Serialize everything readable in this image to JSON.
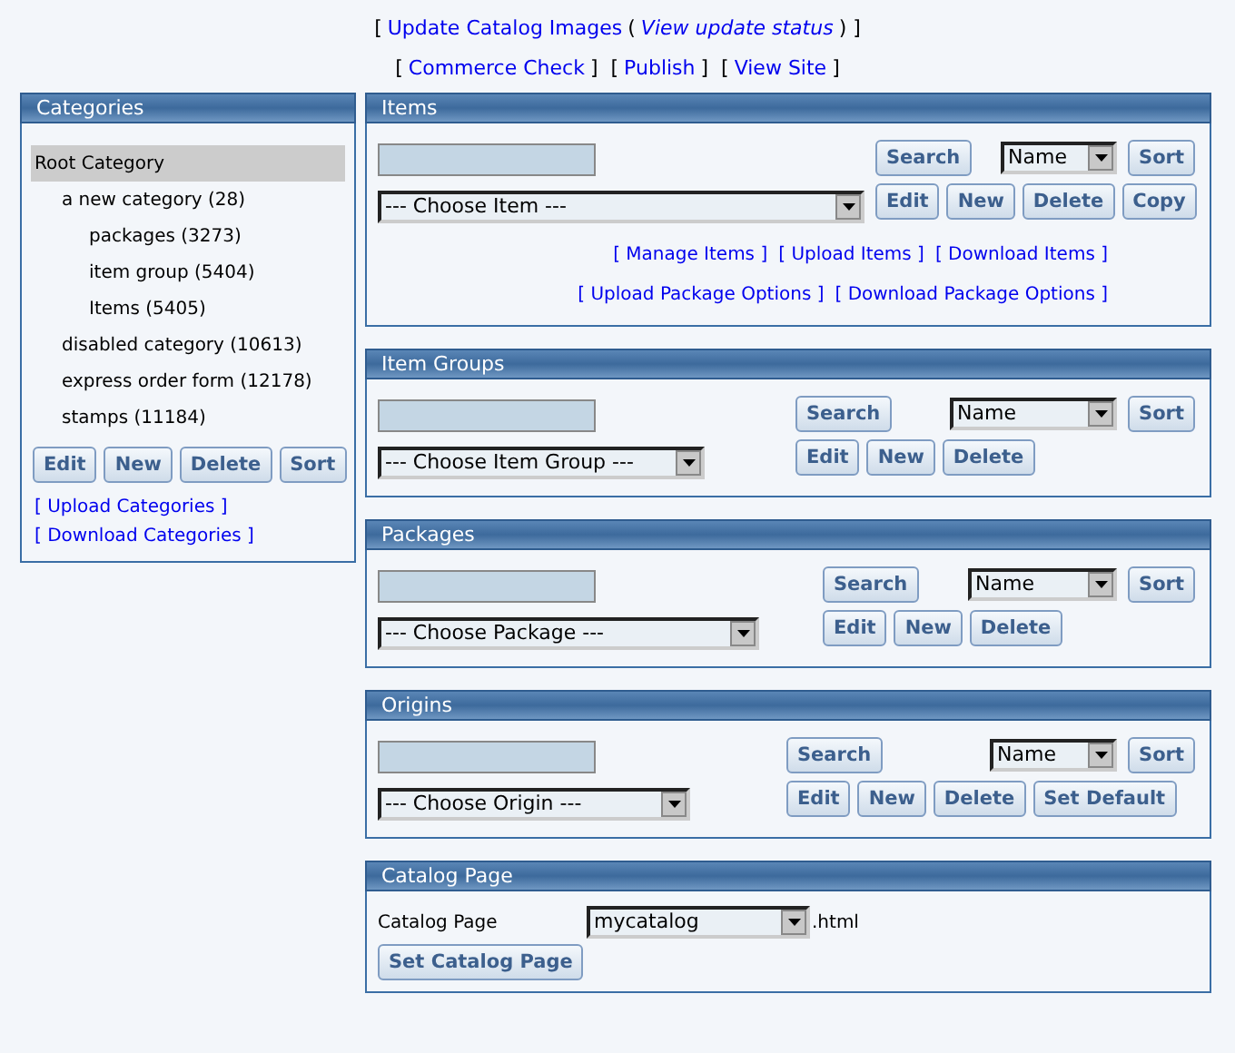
{
  "top_links": [
    [
      {
        "kind": "text",
        "text": "["
      },
      {
        "kind": "link",
        "text": "Update Catalog Images"
      },
      {
        "kind": "text",
        "text": "("
      },
      {
        "kind": "italic_link",
        "text": "View update status"
      },
      {
        "kind": "text",
        "text": ") ]"
      }
    ],
    [
      {
        "kind": "text",
        "text": "["
      },
      {
        "kind": "link",
        "text": "Commerce Check"
      },
      {
        "kind": "text",
        "text": "]  ["
      },
      {
        "kind": "link",
        "text": "Publish"
      },
      {
        "kind": "text",
        "text": "]  ["
      },
      {
        "kind": "link",
        "text": "View Site"
      },
      {
        "kind": "text",
        "text": "]"
      }
    ]
  ],
  "categories": {
    "title": "Categories",
    "tree": [
      {
        "label": "Root Category",
        "selected": true,
        "children": [
          {
            "label": "a new category (28)",
            "selected": false,
            "children": [
              {
                "label": "packages (3273)",
                "selected": false
              },
              {
                "label": "item group (5404)",
                "selected": false
              },
              {
                "label": "Items (5405)",
                "selected": false
              }
            ]
          },
          {
            "label": "disabled category (10613)",
            "selected": false
          },
          {
            "label": "express order form (12178)",
            "selected": false
          },
          {
            "label": "stamps (11184)",
            "selected": false
          }
        ]
      }
    ],
    "buttons": [
      "Edit",
      "New",
      "Delete",
      "Sort"
    ],
    "links": [
      "[ Upload Categories ]",
      "[ Download Categories ]"
    ]
  },
  "panels": [
    {
      "title": "Items",
      "search_button": "Search",
      "sort_field": "Name",
      "sort_button": "Sort",
      "chooser": "--- Choose Item ---",
      "buttons": [
        "Edit",
        "New",
        "Delete",
        "Copy"
      ],
      "link_rows": [
        [
          "[ Manage Items ]",
          "[ Upload Items ]",
          "[ Download Items ]"
        ],
        [
          "[ Upload Package Options ]",
          "[ Download Package Options ]"
        ]
      ]
    },
    {
      "title": "Item Groups",
      "search_button": "Search",
      "sort_field": "Name",
      "sort_button": "Sort",
      "chooser": "--- Choose Item Group ---",
      "buttons": [
        "Edit",
        "New",
        "Delete"
      ]
    },
    {
      "title": "Packages",
      "search_button": "Search",
      "sort_field": "Name",
      "sort_button": "Sort",
      "chooser": "--- Choose Package ---",
      "buttons": [
        "Edit",
        "New",
        "Delete"
      ]
    },
    {
      "title": "Origins",
      "search_button": "Search",
      "sort_field": "Name",
      "sort_button": "Sort",
      "chooser": "--- Choose Origin ---",
      "buttons": [
        "Edit",
        "New",
        "Delete",
        "Set Default"
      ]
    }
  ],
  "catalog_page": {
    "title": "Catalog Page",
    "label": "Catalog Page",
    "value": "mycatalog",
    "suffix": ".html",
    "button": "Set Catalog Page"
  }
}
